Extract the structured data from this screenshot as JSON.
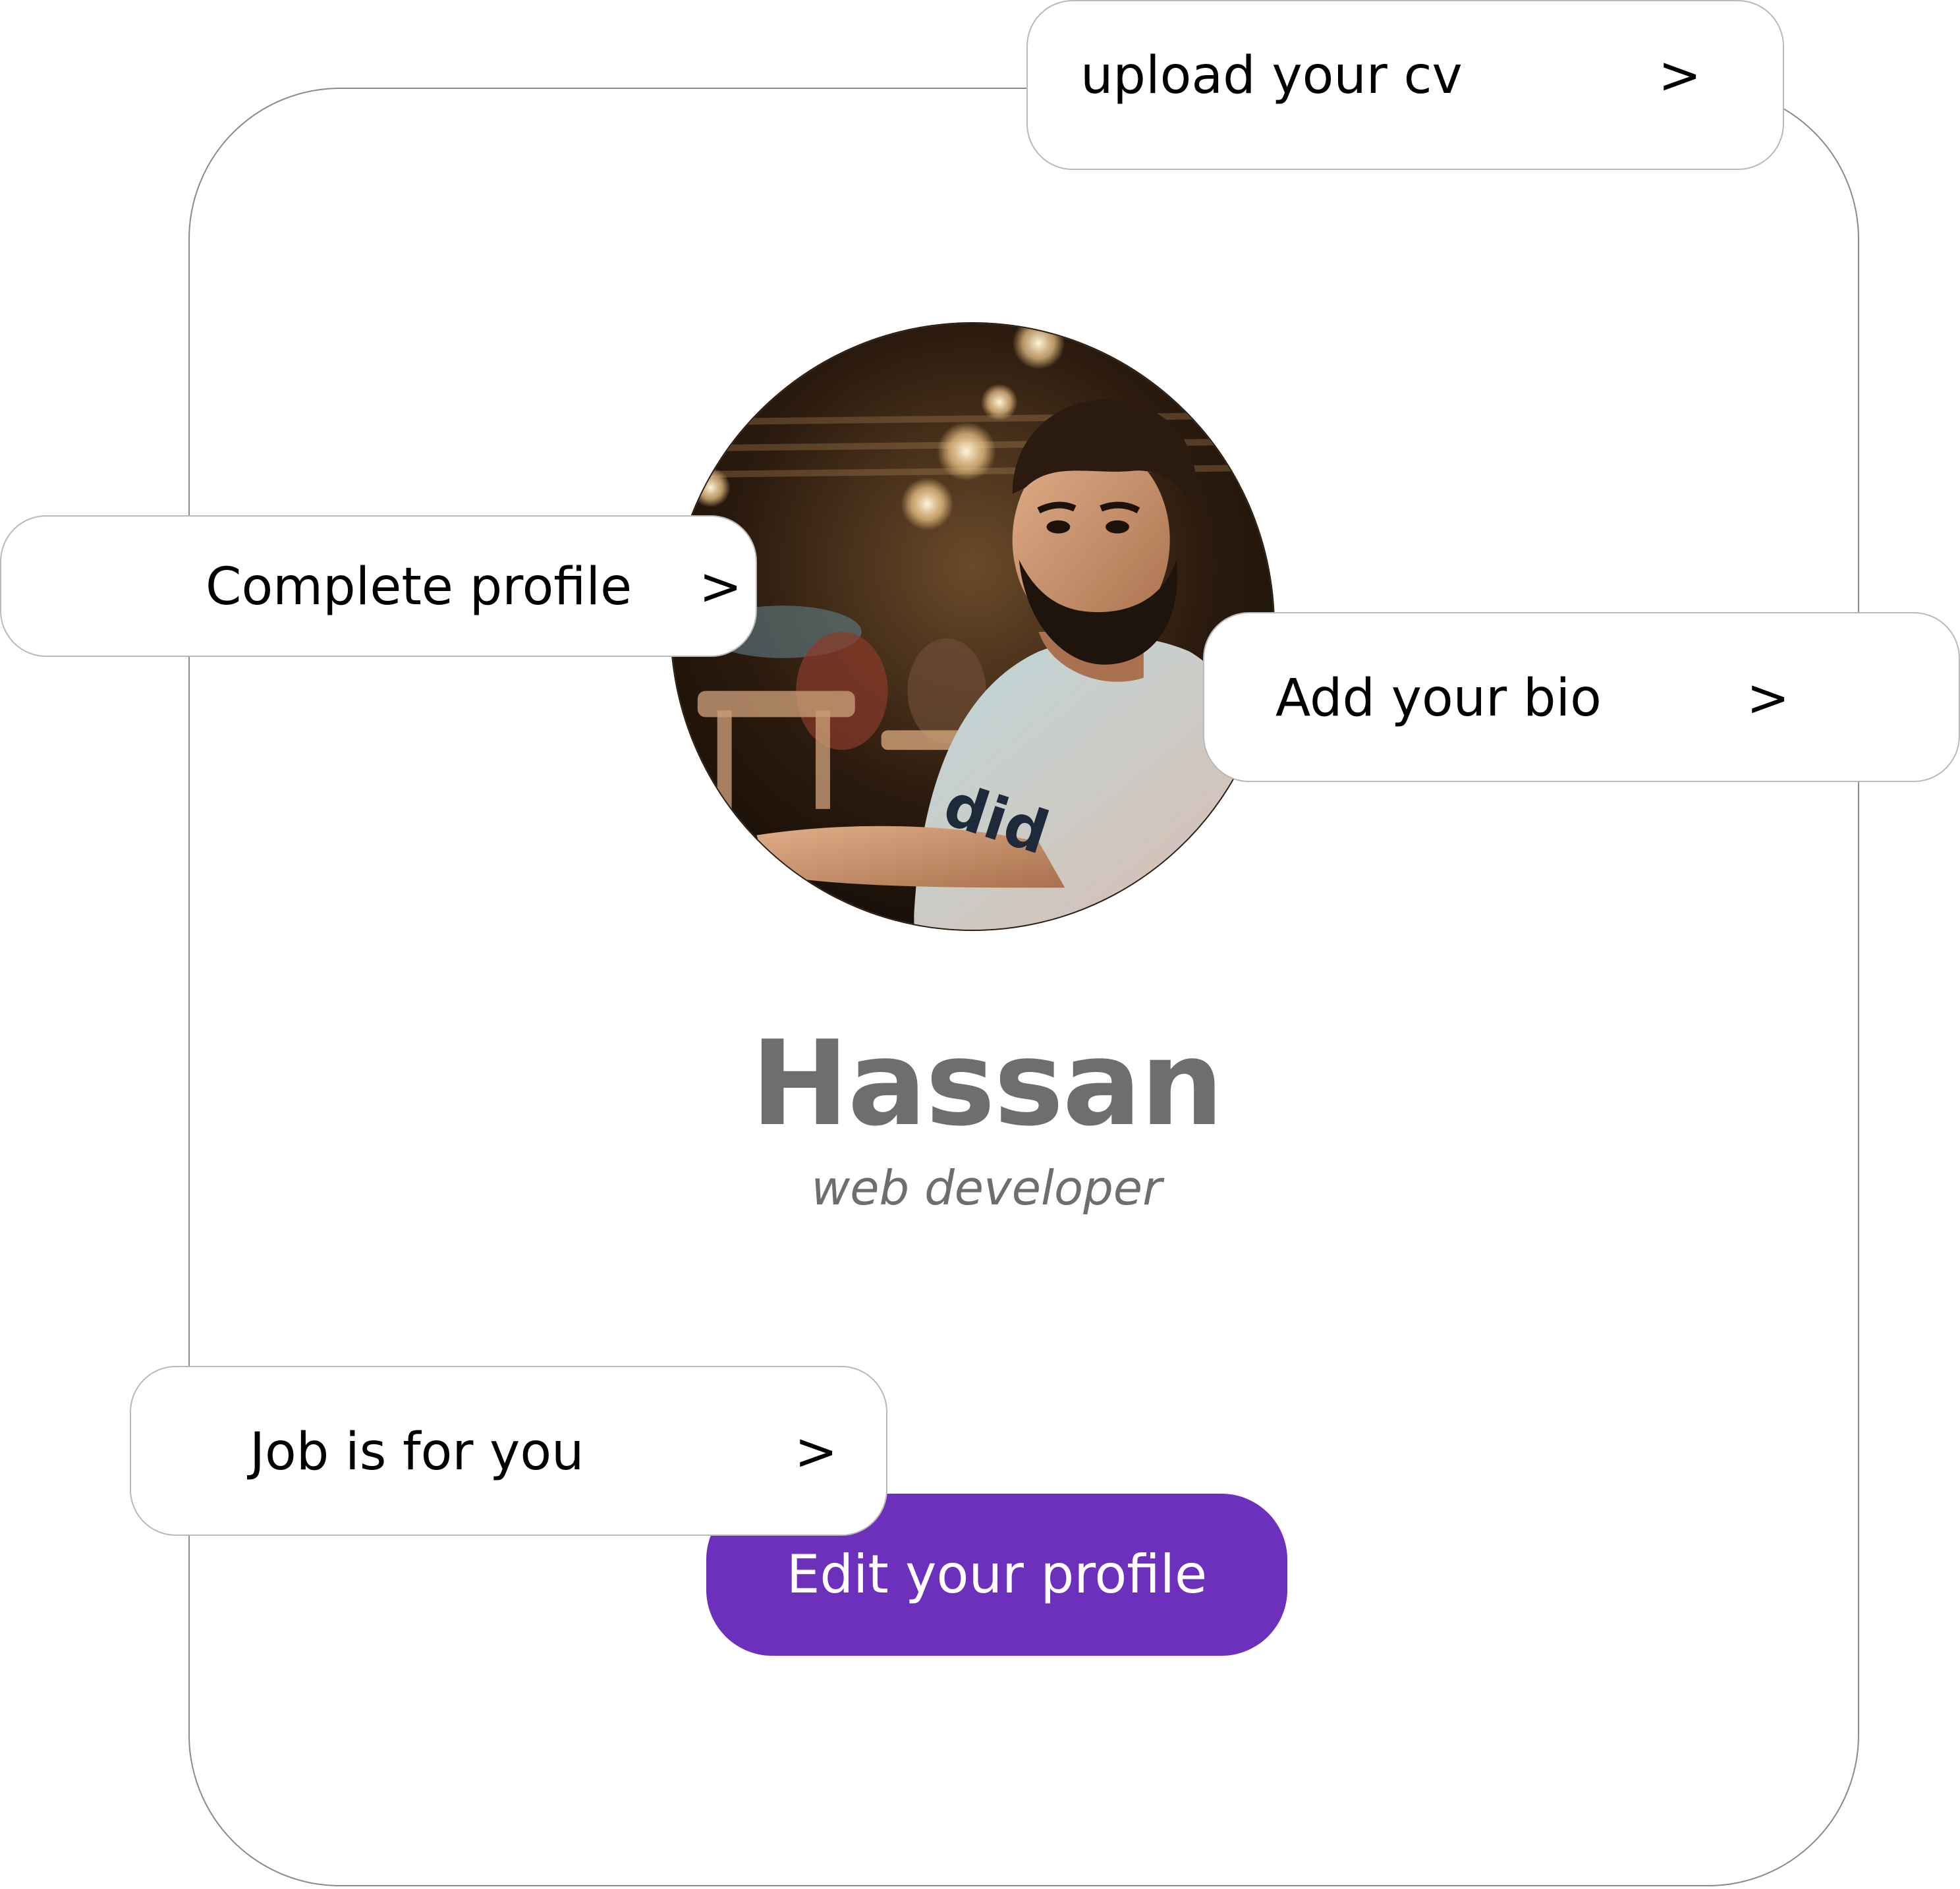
{
  "profile": {
    "name": "Hassan",
    "role": "web developer",
    "avatar_icon": "user-photo"
  },
  "actions": {
    "upload_cv": {
      "label": "upload your cv",
      "arrow": ">"
    },
    "complete_profile": {
      "label": "Complete profile",
      "arrow": ">"
    },
    "add_bio": {
      "label": "Add your bio",
      "arrow": ">"
    },
    "job_for_you": {
      "label": "Job is for you",
      "arrow": ">"
    }
  },
  "primary_button": {
    "label": "Edit your profile",
    "color": "#6c30bd"
  },
  "colors": {
    "name_text": "#6e6e6e",
    "card_border": "#8a8a8a",
    "pill_border": "#b9b9b9"
  }
}
